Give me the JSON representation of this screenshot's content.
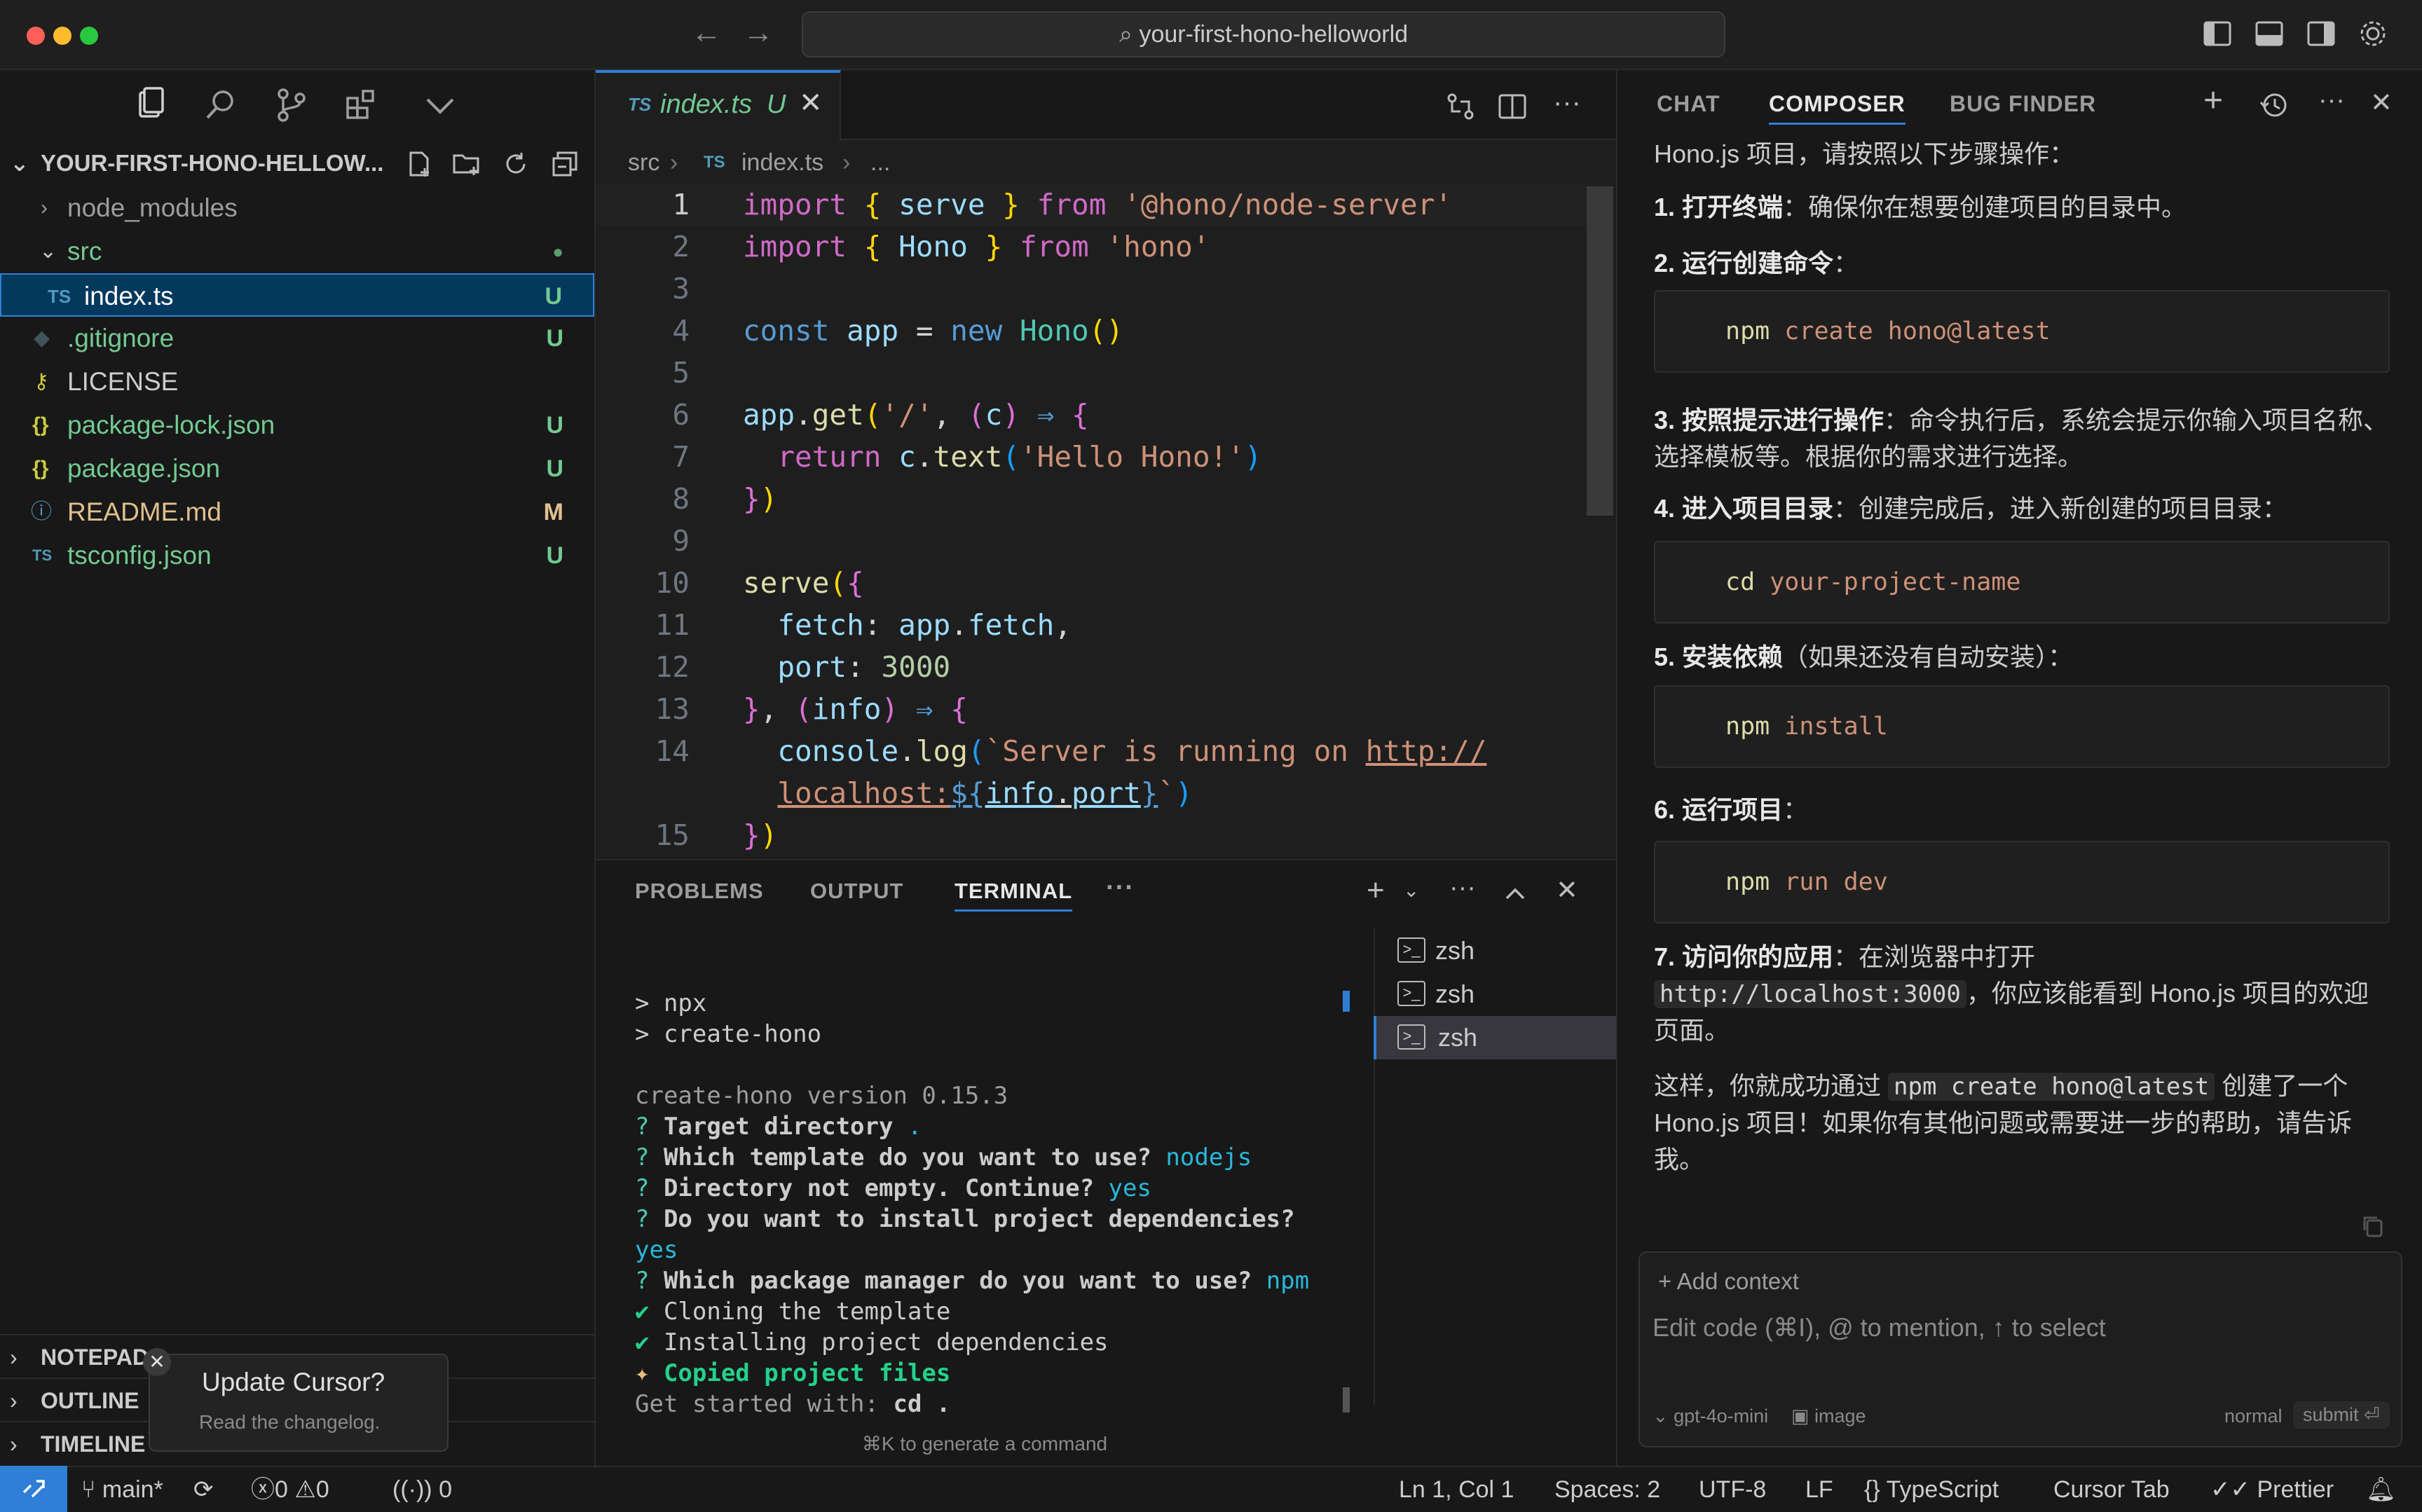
{
  "titlebar": {
    "search_text": "your-first-hono-helloworld"
  },
  "explorer": {
    "title": "YOUR-FIRST-HONO-HELLOW...",
    "items": [
      {
        "label": "node_modules",
        "badge": ""
      },
      {
        "label": "src",
        "badge": "●"
      },
      {
        "label": "index.ts",
        "badge": "U",
        "type_icon": "TS"
      },
      {
        "label": ".gitignore",
        "badge": "U"
      },
      {
        "label": "LICENSE",
        "badge": ""
      },
      {
        "label": "package-lock.json",
        "badge": "U",
        "type_icon": "{}"
      },
      {
        "label": "package.json",
        "badge": "U",
        "type_icon": "{}"
      },
      {
        "label": "README.md",
        "badge": "M",
        "type_icon": "ⓘ"
      },
      {
        "label": "tsconfig.json",
        "badge": "U",
        "type_icon": "TS"
      }
    ],
    "sections": [
      "NOTEPADS",
      "OUTLINE",
      "TIMELINE"
    ]
  },
  "editor": {
    "tab": {
      "lang": "TS",
      "name": "index.ts",
      "status": "U"
    },
    "breadcrumb": {
      "folder": "src",
      "lang": "TS",
      "file": "index.ts",
      "more": "..."
    },
    "line_numbers": [
      "1",
      "2",
      "3",
      "4",
      "5",
      "6",
      "7",
      "8",
      "9",
      "10",
      "11",
      "12",
      "13",
      "14",
      "15"
    ]
  },
  "panel": {
    "tabs": [
      "PROBLEMS",
      "OUTPUT",
      "TERMINAL"
    ],
    "more": "···",
    "terminals": [
      "zsh",
      "zsh",
      "zsh"
    ],
    "hint": "⌘K to generate a command"
  },
  "terminal": {
    "cmd1": "> npx",
    "cmd2": "> create-hono",
    "version": "create-hono version 0.15.3",
    "q1": "Target directory",
    "a1": ".",
    "q2": "Which template do you want to use?",
    "a2": "nodejs",
    "q3": "Directory not empty. Continue?",
    "a3": "yes",
    "q4": "Do you want to install project dependencies?",
    "a4": "yes",
    "q5": "Which package manager do you want to use?",
    "a5": "npm",
    "s1": "Cloning the template",
    "s2": "Installing project dependencies",
    "s3": "Copied project files",
    "started": "Get started with:",
    "started_cmd": "cd ."
  },
  "right_pane": {
    "tabs": [
      "CHAT",
      "COMPOSER",
      "BUG FINDER"
    ],
    "intro": "Hono.js 项目，请按照以下步骤操作：",
    "step1_b": "1. 打开终端",
    "step1": "：确保你在想要创建项目的目录中。",
    "step2_b": "2. 运行创建命令",
    "step2": "：",
    "code1_a": "npm",
    "code1_b": "create hono@latest",
    "step3_b": "3. 按照提示进行操作",
    "step3": "：命令执行后，系统会提示你输入项目名称、选择模板等。根据你的需求进行选择。",
    "step4_b": "4. 进入项目目录",
    "step4": "：创建完成后，进入新创建的项目目录：",
    "code2_a": "cd",
    "code2_b": "your-project-name",
    "step5_b": "5. 安装依赖",
    "step5": "（如果还没有自动安装）：",
    "code3_a": "npm",
    "code3_b": "install",
    "step6_b": "6. 运行项目",
    "step6": "：",
    "code4_a": "npm",
    "code4_b": "run dev",
    "step7_b": "7. 访问你的应用",
    "step7": "：在浏览器中打开",
    "step7_code": "http://localhost:3000",
    "step7_tail": "，你应该能看到 Hono.js 项目的欢迎页面。",
    "outro_a": "这样，你就成功通过",
    "outro_code": "npm create hono@latest",
    "outro_b": "创建了一个 Hono.js 项目！如果你有其他问题或需要进一步的帮助，请告诉我。",
    "composer": {
      "add_context": "+ Add context",
      "placeholder": "Edit code (⌘I), @ to mention, ↑ to select",
      "model": "gpt-4o-mini",
      "image": "image",
      "mode": "normal",
      "submit": "submit ⏎"
    }
  },
  "toast": {
    "title": "Update Cursor?",
    "subtitle": "Read the changelog."
  },
  "statusbar": {
    "branch": "main*",
    "errors": "0",
    "warnings": "0",
    "ports": "0",
    "position": "Ln 1, Col 1",
    "spaces": "Spaces: 2",
    "encoding": "UTF-8",
    "eol": "LF",
    "language": "TypeScript",
    "cursor_tab": "Cursor Tab",
    "prettier": "Prettier"
  }
}
